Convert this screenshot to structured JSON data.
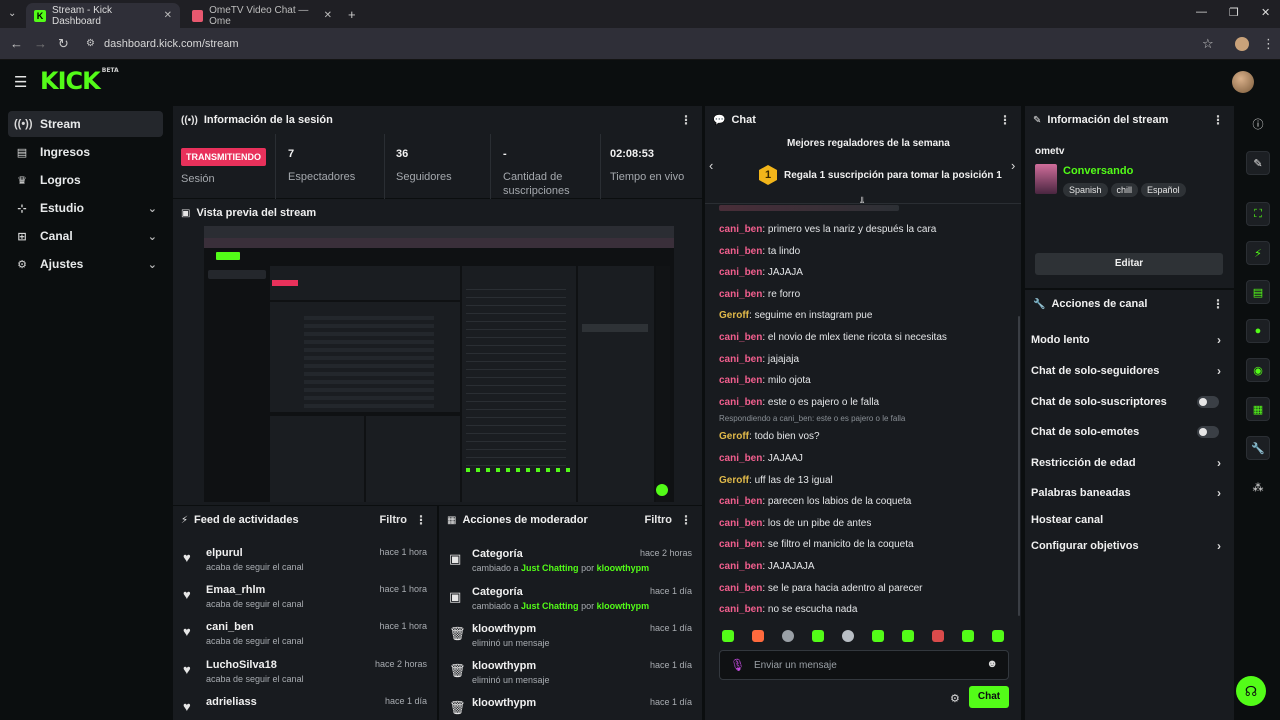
{
  "browser": {
    "tabs": [
      {
        "label": "Stream - Kick Dashboard",
        "active": true
      },
      {
        "label": "OmeTV Video Chat — Ome",
        "active": false
      }
    ],
    "url": "dashboard.kick.com/stream"
  },
  "app": {
    "logo": "KICK",
    "logo_badge": "BETA"
  },
  "nav": {
    "items": [
      {
        "label": "Stream",
        "icon": "stream-icon"
      },
      {
        "label": "Ingresos",
        "icon": "income-icon"
      },
      {
        "label": "Logros",
        "icon": "trophy-icon"
      },
      {
        "label": "Estudio",
        "icon": "studio-icon"
      },
      {
        "label": "Canal",
        "icon": "channel-icon"
      },
      {
        "label": "Ajustes",
        "icon": "gear-icon"
      }
    ]
  },
  "session": {
    "title": "Información de la sesión",
    "status_badge": "TRANSMITIENDO",
    "status_label": "Sesión",
    "stats": [
      {
        "value": "7",
        "label": "Espectadores"
      },
      {
        "value": "36",
        "label": "Seguidores"
      },
      {
        "value": "-",
        "label": "Cantidad de suscripciones"
      },
      {
        "value": "02:08:53",
        "label": "Tiempo en vivo"
      }
    ]
  },
  "preview": {
    "title": "Vista previa del stream"
  },
  "activity": {
    "title": "Feed de actividades",
    "filter": "Filtro",
    "items": [
      {
        "name": "elpurul",
        "sub": "acaba de seguir el canal",
        "time": "hace 1 hora"
      },
      {
        "name": "Emaa_rhlm",
        "sub": "acaba de seguir el canal",
        "time": "hace 1 hora"
      },
      {
        "name": "cani_ben",
        "sub": "acaba de seguir el canal",
        "time": "hace 1 hora"
      },
      {
        "name": "LuchoSilva18",
        "sub": "acaba de seguir el canal",
        "time": "hace 2 horas"
      },
      {
        "name": "adrieliass",
        "sub": "",
        "time": "hace 1 día"
      }
    ]
  },
  "moderator": {
    "title": "Acciones de moderador",
    "filter": "Filtro",
    "items": [
      {
        "name": "Categoría",
        "pre": "cambiado a",
        "cat": "Just Chatting",
        "por": "por",
        "by": "kloowthypm",
        "time": "hace 2 horas",
        "icon": "category-icon"
      },
      {
        "name": "Categoría",
        "pre": "cambiado a",
        "cat": "Just Chatting",
        "por": "por",
        "by": "kloowthypm",
        "time": "hace 1 día",
        "icon": "category-icon"
      },
      {
        "name": "kloowthypm",
        "pre": "eliminó un mensaje",
        "time": "hace 1 día",
        "icon": "trash-icon"
      },
      {
        "name": "kloowthypm",
        "pre": "eliminó un mensaje",
        "time": "hace 1 día",
        "icon": "trash-icon"
      },
      {
        "name": "kloowthypm",
        "pre": "",
        "time": "hace 1 día",
        "icon": "trash-icon"
      }
    ]
  },
  "chat": {
    "title": "Chat",
    "top_gifters_title": "Mejores regaladores de la semana",
    "top_gifter_rank": "1",
    "top_gifter_text": "Regala 1 suscripción para tomar la posición 1",
    "messages": [
      {
        "user": "cani_ben",
        "text": "primero ves la nariz y después la cara",
        "color": "#f25f8e"
      },
      {
        "user": "cani_ben",
        "text": "ta lindo",
        "color": "#f25f8e"
      },
      {
        "user": "cani_ben",
        "text": "JAJAJA",
        "color": "#f25f8e"
      },
      {
        "user": "cani_ben",
        "text": "re forro",
        "color": "#f25f8e"
      },
      {
        "user": "Geroff",
        "text": "seguime en instagram pue",
        "color": "#e0b94a"
      },
      {
        "user": "cani_ben",
        "text": "el novio de mlex tiene ricota si necesitas",
        "color": "#f25f8e"
      },
      {
        "user": "cani_ben",
        "text": "jajajaja",
        "color": "#f25f8e"
      },
      {
        "user": "cani_ben",
        "text": "milo ojota",
        "color": "#f25f8e"
      },
      {
        "user": "cani_ben",
        "text": "este o es pajero o le falla",
        "color": "#f25f8e"
      },
      {
        "user": "Geroff",
        "text": "todo bien vos?",
        "color": "#e0b94a",
        "reply": "Respondiendo a cani_ben: este o es pajero o le falla"
      },
      {
        "user": "cani_ben",
        "text": "JAJAAJ",
        "color": "#f25f8e"
      },
      {
        "user": "Geroff",
        "text": "uff las de 13 igual",
        "color": "#e0b94a"
      },
      {
        "user": "cani_ben",
        "text": "parecen los labios de la coqueta",
        "color": "#f25f8e"
      },
      {
        "user": "cani_ben",
        "text": "los de un pibe de antes",
        "color": "#f25f8e"
      },
      {
        "user": "cani_ben",
        "text": "se filtro el manicito de la coqueta",
        "color": "#f25f8e"
      },
      {
        "user": "cani_ben",
        "text": "JAJAJAJA",
        "color": "#f25f8e"
      },
      {
        "user": "cani_ben",
        "text": "se le para hacia adentro al parecer",
        "color": "#f25f8e"
      },
      {
        "user": "cani_ben",
        "text": "no se escucha nada",
        "color": "#f25f8e"
      }
    ],
    "input_placeholder": "Enviar un mensaje",
    "send_label": "Chat"
  },
  "stream_info": {
    "title": "Información del stream",
    "channel": "ometv",
    "stream_title": "Conversando",
    "tags": [
      "Spanish",
      "chill",
      "Español"
    ],
    "edit_label": "Editar"
  },
  "channel_actions": {
    "title": "Acciones de canal",
    "items": [
      {
        "label": "Modo lento",
        "control": "arrow"
      },
      {
        "label": "Chat de solo-seguidores",
        "control": "arrow"
      },
      {
        "label": "Chat de solo-suscriptores",
        "control": "toggle"
      },
      {
        "label": "Chat de solo-emotes",
        "control": "toggle"
      },
      {
        "label": "Restricción de edad",
        "control": "arrow"
      },
      {
        "label": "Palabras baneadas",
        "control": "arrow"
      },
      {
        "label": "Hostear canal",
        "control": "none"
      },
      {
        "label": "Configurar objetivos",
        "control": "arrow"
      }
    ]
  },
  "colors": {
    "accent": "#53fc18",
    "live": "#e8315b",
    "panel": "#181b1f",
    "background": "#0b0e0f"
  }
}
